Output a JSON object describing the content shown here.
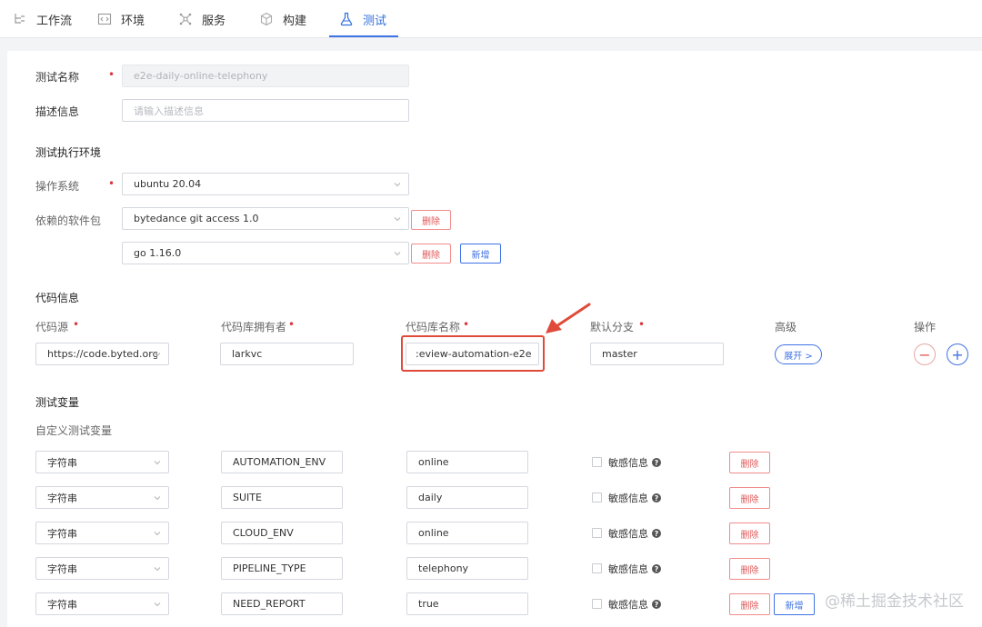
{
  "nav": {
    "tabs": [
      {
        "label": "工作流",
        "icon": "workflow-icon"
      },
      {
        "label": "环境",
        "icon": "code-icon"
      },
      {
        "label": "服务",
        "icon": "network-icon"
      },
      {
        "label": "构建",
        "icon": "cube-icon"
      },
      {
        "label": "测试",
        "icon": "flask-icon",
        "active": true
      }
    ]
  },
  "form": {
    "name_label": "测试名称",
    "name_value": "e2e-daily-online-telephony",
    "desc_label": "描述信息",
    "desc_placeholder": "请输入描述信息"
  },
  "env": {
    "title": "测试执行环境",
    "os_label": "操作系统",
    "os_value": "ubuntu 20.04",
    "pkg_label": "依赖的软件包",
    "packages": [
      "bytedance git access 1.0",
      "go 1.16.0"
    ],
    "delete_label": "删除",
    "add_label": "新增"
  },
  "code": {
    "title": "代码信息",
    "headers": {
      "source": "代码源",
      "owner": "代码库拥有者",
      "repo": "代码库名称",
      "branch": "默认分支",
      "advanced": "高级",
      "ops": "操作"
    },
    "row": {
      "source": "https://code.byted.org",
      "owner": "larkvc",
      "repo": ":eview-automation-e2e",
      "branch": "master",
      "expand": "展开 >"
    }
  },
  "vars": {
    "title": "测试变量",
    "subtitle": "自定义测试变量",
    "sensitive_label": "敏感信息",
    "delete_label": "删除",
    "add_label": "新增",
    "rows": [
      {
        "type": "字符串",
        "key": "AUTOMATION_ENV",
        "value": "online"
      },
      {
        "type": "字符串",
        "key": "SUITE",
        "value": "daily"
      },
      {
        "type": "字符串",
        "key": "CLOUD_ENV",
        "value": "online"
      },
      {
        "type": "字符串",
        "key": "PIPELINE_TYPE",
        "value": "telephony"
      },
      {
        "type": "字符串",
        "key": "NEED_REPORT",
        "value": "true"
      }
    ]
  },
  "watermark": "@稀土掘金技术社区",
  "colors": {
    "accent": "#3f72e5",
    "danger": "#e25757",
    "highlight": "#e04a3a"
  }
}
